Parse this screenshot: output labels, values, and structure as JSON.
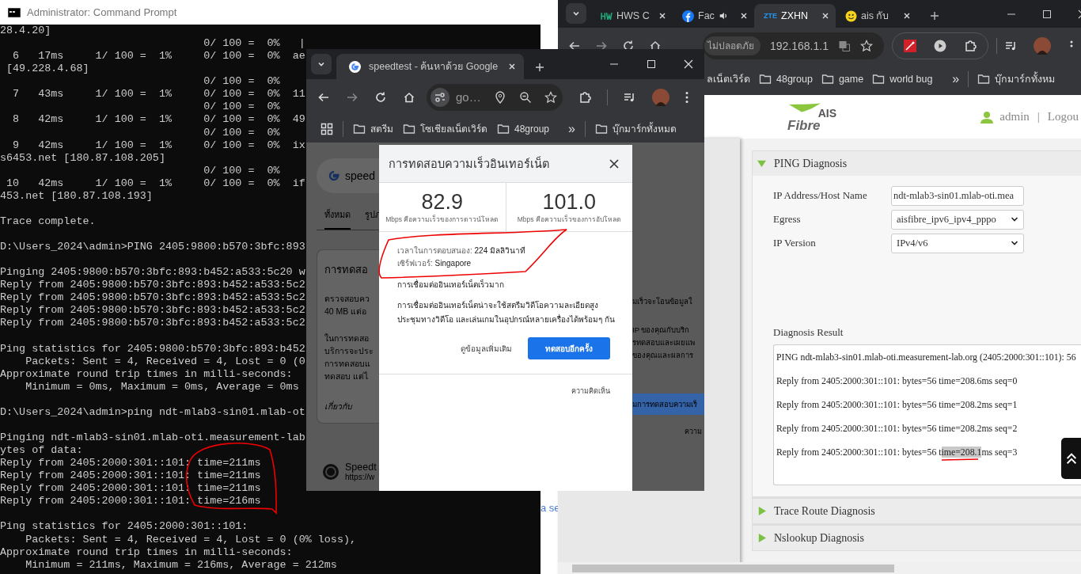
{
  "behind_window": {
    "link": "a se"
  },
  "cmd_window": {
    "title": "Administrator: Command Prompt",
    "lines": [
      {
        "kind": "text",
        "text": "28.4.20]"
      },
      {
        "kind": "text",
        "text": "                                0/ 100 =  0%   |"
      },
      {
        "kind": "text",
        "text": "  6   17ms     1/ 100 =  1%     0/ 100 =  0%  ae"
      },
      {
        "kind": "text",
        "text": " [49.228.4.68]"
      },
      {
        "kind": "text",
        "text": "                                0/ 100 =  0%"
      },
      {
        "kind": "text",
        "text": "  7   43ms     1/ 100 =  1%     0/ 100 =  0%  11"
      },
      {
        "kind": "text",
        "text": "                                0/ 100 =  0%"
      },
      {
        "kind": "text",
        "text": "  8   42ms     1/ 100 =  1%     0/ 100 =  0%  49"
      },
      {
        "kind": "text",
        "text": "                                0/ 100 =  0%"
      },
      {
        "kind": "text",
        "text": "  9   42ms     1/ 100 =  1%     0/ 100 =  0%  ix"
      },
      {
        "kind": "text",
        "text": "s6453.net [180.87.108.205]"
      },
      {
        "kind": "text",
        "text": "                                0/ 100 =  0%"
      },
      {
        "kind": "text",
        "text": " 10   42ms     1/ 100 =  1%     0/ 100 =  0%  if"
      },
      {
        "kind": "text",
        "text": "453.net [180.87.108.193]"
      },
      {
        "kind": "blank"
      },
      {
        "kind": "text",
        "text": "Trace complete."
      },
      {
        "kind": "blank"
      },
      {
        "kind": "text",
        "text": "D:\\Users_2024\\admin>PING 2405:9800:b570:3bfc:893"
      },
      {
        "kind": "blank"
      },
      {
        "kind": "text",
        "text": "Pinging 2405:9800:b570:3bfc:893:b452:a533:5c20 w"
      },
      {
        "kind": "text",
        "text": "Reply from 2405:9800:b570:3bfc:893:b452:a533:5c2"
      },
      {
        "kind": "text",
        "text": "Reply from 2405:9800:b570:3bfc:893:b452:a533:5c2"
      },
      {
        "kind": "text",
        "text": "Reply from 2405:9800:b570:3bfc:893:b452:a533:5c2"
      },
      {
        "kind": "text",
        "text": "Reply from 2405:9800:b570:3bfc:893:b452:a533:5c2"
      },
      {
        "kind": "blank"
      },
      {
        "kind": "text",
        "text": "Ping statistics for 2405:9800:b570:3bfc:893:b452"
      },
      {
        "kind": "text",
        "text": "    Packets: Sent = 4, Received = 4, Lost = 0 (0"
      },
      {
        "kind": "text",
        "text": "Approximate round trip times in milli-seconds:"
      },
      {
        "kind": "text",
        "text": "    Minimum = 0ms, Maximum = 0ms, Average = 0ms"
      },
      {
        "kind": "blank"
      },
      {
        "kind": "text",
        "text": "D:\\Users_2024\\admin>ping ndt-mlab3-sin01.mlab-ot"
      },
      {
        "kind": "blank"
      },
      {
        "kind": "text",
        "text": "Pinging ndt-mlab3-sin01.mlab-oti.measurement-lab"
      },
      {
        "kind": "text",
        "text": "ytes of data:"
      },
      {
        "kind": "text",
        "text": "Reply from 2405:2000:301::101: time=211ms"
      },
      {
        "kind": "text",
        "text": "Reply from 2405:2000:301::101: time=211ms"
      },
      {
        "kind": "text",
        "text": "Reply from 2405:2000:301::101: time=211ms"
      },
      {
        "kind": "text",
        "text": "Reply from 2405:2000:301::101: time=216ms"
      },
      {
        "kind": "blank"
      },
      {
        "kind": "text",
        "text": "Ping statistics for 2405:2000:301::101:"
      },
      {
        "kind": "text",
        "text": "    Packets: Sent = 4, Received = 4, Lost = 0 (0% loss),"
      },
      {
        "kind": "text",
        "text": "Approximate round trip times in milli-seconds:"
      },
      {
        "kind": "text",
        "text": "    Minimum = 211ms, Maximum = 216ms, Average = 212ms"
      }
    ]
  },
  "router_browser": {
    "tabs": [
      {
        "kind": "hws",
        "title": "HWS C",
        "selected": false,
        "audio": false
      },
      {
        "kind": "facebook",
        "title": "Fac",
        "selected": false,
        "audio": true
      },
      {
        "kind": "zte",
        "favicon_text": "ZTE",
        "title": "ZXHN",
        "selected": true,
        "audio": false
      },
      {
        "kind": "emoji",
        "title": "ais กับ",
        "selected": false,
        "audio": false
      }
    ],
    "address": {
      "security": "ไม่ปลอดภัย",
      "url": "192.168.1.1"
    },
    "bookmarks": [
      {
        "kind": "plain",
        "label": "ลเน็ตเวิร์ด"
      },
      {
        "kind": "folder",
        "label": "48group"
      },
      {
        "kind": "folder",
        "label": "game"
      },
      {
        "kind": "folder",
        "label": "world bug"
      },
      {
        "kind": "more",
        "label": "»"
      },
      {
        "kind": "folder",
        "label": "บุ๊กมาร์กทั้งหม"
      }
    ],
    "logo": {
      "top": "AIS",
      "bottom": "Fibre"
    },
    "user": {
      "name": "admin",
      "separator": "|",
      "logout": "Logou"
    },
    "panels": [
      {
        "title": "PING Diagnosis",
        "expanded": true
      },
      {
        "title": "Trace Route Diagnosis",
        "expanded": false
      },
      {
        "title": "Nslookup Diagnosis",
        "expanded": false
      }
    ],
    "form": [
      {
        "kind": "input",
        "label": "IP Address/Host Name",
        "value": "ndt-mlab3-sin01.mlab-oti.mea"
      },
      {
        "kind": "select",
        "label": "Egress",
        "value": "aisfibre_ipv6_ipv4_pppo"
      },
      {
        "kind": "select",
        "label": "IP Version",
        "value": "IPv4/v6"
      }
    ],
    "result_title": "Diagnosis Result",
    "result_lines": [
      {
        "before": "PING ndt-mlab3-sin01.mlab-oti.measurement-lab.org (2405:2000:301::101): 56"
      },
      {
        "before": "Reply from 2405:2000:301::101: bytes=56 time=208.6ms seq=0"
      },
      {
        "before": "Reply from 2405:2000:301::101: bytes=56 time=208.2ms seq=1"
      },
      {
        "before": "Reply from 2405:2000:301::101: bytes=56 time=208.2ms seq=2"
      },
      {
        "before": "Reply from 2405:2000:301::101: bytes=56 t",
        "selected": "ime=208.1",
        "after": "ms seq=3"
      }
    ]
  },
  "search_browser": {
    "tab": {
      "title": "speedtest - ค้นหาด้วย Google",
      "selected": true
    },
    "address": {
      "url": "go…"
    },
    "bookmarks": [
      {
        "kind": "folder",
        "label": "สตรีม"
      },
      {
        "kind": "folder",
        "label": "โซเชียลเน็ตเวิร์ด"
      },
      {
        "kind": "folder",
        "label": "48group"
      },
      {
        "kind": "more",
        "label": "»"
      },
      {
        "kind": "folder",
        "label": "บุ๊กมาร์กทั้งหมด"
      }
    ],
    "page_left": {
      "search": "speed",
      "tabs": [
        {
          "label": "ทั้งหมด",
          "selected": true
        },
        {
          "label": "รูปภ",
          "selected": false
        }
      ],
      "card_title": "การทดสอ",
      "card_lines": [
        "ตรวจสอบคว",
        "40 MB แต่อ"
      ],
      "card_lines_2": [
        "ในการทดสอ",
        "บริการจะประ",
        "การทดสอบแ",
        "ทดสอบ แต่ไ"
      ],
      "about": "เกี่ยวกับ",
      "result_title": "Speedt",
      "result_url": "https://w"
    },
    "page_right": {
      "line": "มเร็วจะโอนข้อมูลใ",
      "lines_2": [
        "IP ของคุณกับบริก",
        "รทดสอบและเผยแพ",
        "ของคุณและผลการ"
      ],
      "button": "มการทดสอบความเร็",
      "footer": "ความ"
    }
  },
  "dialog": {
    "title": "การทดสอบความเร็วอินเทอร์เน็ต",
    "metrics": [
      {
        "value": "82.9",
        "label": "Mbps คือความเร็วของการดาวน์โหลด"
      },
      {
        "value": "101.0",
        "label": "Mbps คือความเร็วของการอัปโหลด"
      }
    ],
    "details": [
      {
        "label": "เวลาในการตอบสนอง:",
        "value": "224 มิลลิวินาที"
      },
      {
        "label": "เซิร์ฟเวอร์:",
        "value": "Singapore"
      }
    ],
    "verdict": "การเชื่อมต่ออินเทอร์เน็ตเร็วมาก",
    "description": "การเชื่อมต่ออินเทอร์เน็ตน่าจะใช้สตรีมวิดีโอความละเอียดสูง ประชุมทางวิดีโอ และเล่นเกมในอุปกรณ์หลายเครื่องได้พร้อมๆ กัน",
    "more": "ดูข้อมูลเพิ่มเติม",
    "retest": "ทดสอบอีกครั้ง",
    "feedback": "ความคิดเห็น"
  }
}
